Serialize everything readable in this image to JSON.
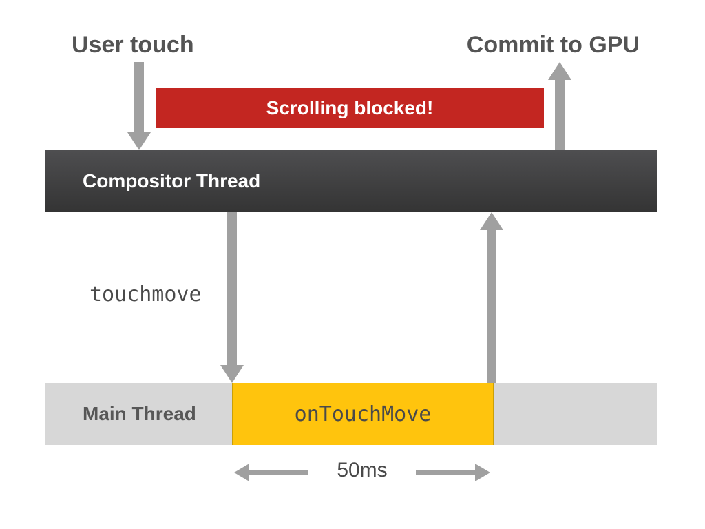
{
  "labels": {
    "user_touch": "User touch",
    "commit_gpu": "Commit to GPU",
    "blocked": "Scrolling blocked!",
    "compositor": "Compositor Thread",
    "main_thread": "Main Thread",
    "touchmove": "touchmove",
    "on_touchmove": "onTouchMove",
    "duration": "50ms"
  },
  "colors": {
    "blocked_bg": "#c32621",
    "compositor_bg": "#424244",
    "main_bg": "#d7d7d7",
    "task_bg": "#ffc40d",
    "arrow": "#a0a0a0"
  },
  "chart_data": {
    "type": "timeline",
    "threads": [
      {
        "name": "Compositor Thread",
        "row": 0
      },
      {
        "name": "Main Thread",
        "row": 1,
        "tasks": [
          {
            "name": "onTouchMove",
            "duration_ms": 50
          }
        ]
      }
    ],
    "events": [
      {
        "name": "User touch",
        "from": "external",
        "to": "Compositor Thread"
      },
      {
        "name": "touchmove",
        "from": "Compositor Thread",
        "to": "Main Thread"
      },
      {
        "name": "return",
        "from": "Main Thread",
        "to": "Compositor Thread"
      },
      {
        "name": "Commit to GPU",
        "from": "Compositor Thread",
        "to": "external"
      }
    ],
    "annotation": "Scrolling blocked!"
  }
}
